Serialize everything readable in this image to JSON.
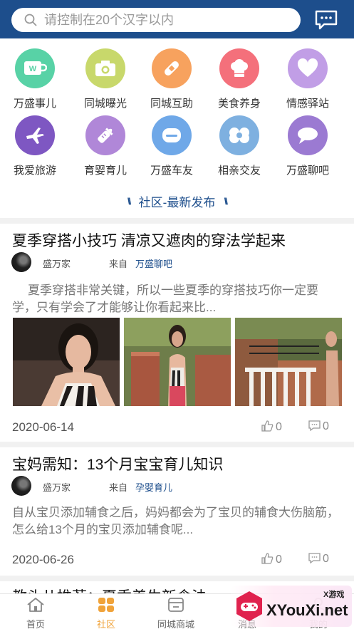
{
  "search": {
    "placeholder": "请控制在20个汉字以内"
  },
  "grid": [
    {
      "label": "万盛事儿",
      "icon": "wechat-cup-icon",
      "color": "#58d2a6"
    },
    {
      "label": "同城曝光",
      "icon": "camera-icon",
      "color": "#c8d86b"
    },
    {
      "label": "同城互助",
      "icon": "bandage-icon",
      "color": "#f7a25e"
    },
    {
      "label": "美食养身",
      "icon": "chef-hat-icon",
      "color": "#f4707b"
    },
    {
      "label": "情感驿站",
      "icon": "heart-icon",
      "color": "#c19ee6"
    },
    {
      "label": "我爱旅游",
      "icon": "airplane-icon",
      "color": "#7e57c2"
    },
    {
      "label": "育婴育儿",
      "icon": "baby-bottle-icon",
      "color": "#b087d8"
    },
    {
      "label": "万盛车友",
      "icon": "car-icon",
      "color": "#6fa8e8"
    },
    {
      "label": "相亲交友",
      "icon": "heart-knot-icon",
      "color": "#7eb0e0"
    },
    {
      "label": "万盛聊吧",
      "icon": "chat-bubble-icon",
      "color": "#9b7ad2"
    }
  ],
  "section": {
    "title": "社区-最新发布"
  },
  "posts": [
    {
      "title": "夏季穿搭小技巧 清凉又遮肉的穿法学起来",
      "author": "盛万家",
      "from_label": "来自",
      "group": "万盛聊吧",
      "excerpt": "夏季穿搭非常关键，所以一些夏季的穿搭技巧你一定要学，只有学会了才能够让你看起来比...",
      "date": "2020-06-14",
      "likes": "0",
      "comments": "0"
    },
    {
      "title": "宝妈需知：13个月宝宝育儿知识",
      "author": "盛万家",
      "from_label": "来自",
      "group": "孕婴育儿",
      "excerpt": "自从宝贝添加辅食之后，妈妈都会为了宝贝的辅食大伤脑筋，怎么给13个月的宝贝添加辅食呢...",
      "date": "2020-06-26",
      "likes": "0",
      "comments": "0"
    },
    {
      "title": "教头儿推荐：夏季养生新食法"
    }
  ],
  "tabs": [
    {
      "label": "首页",
      "icon": "home-icon"
    },
    {
      "label": "社区",
      "icon": "community-grid-icon",
      "active": true
    },
    {
      "label": "同城商城",
      "icon": "mall-icon"
    },
    {
      "label": "消息",
      "icon": "message-icon"
    },
    {
      "label": "我的",
      "icon": "profile-icon"
    }
  ],
  "watermark": {
    "text": "XYouXi.net",
    "tag": "X游戏"
  },
  "colors": {
    "brand": "#1d4e8c",
    "active_tab": "#f0a33a",
    "link": "#1d4e8c"
  }
}
